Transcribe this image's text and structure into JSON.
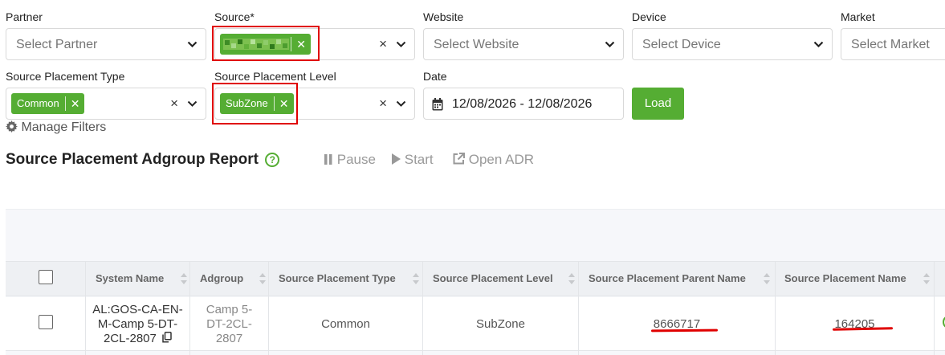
{
  "filters": {
    "partner": {
      "label": "Partner",
      "placeholder": "Select Partner"
    },
    "source": {
      "label": "Source*",
      "tag": ""
    },
    "website": {
      "label": "Website",
      "placeholder": "Select Website"
    },
    "device": {
      "label": "Device",
      "placeholder": "Select Device"
    },
    "market": {
      "label": "Market",
      "placeholder": "Select Market"
    },
    "placement_type": {
      "label": "Source Placement Type",
      "tag": "Common"
    },
    "placement_level": {
      "label": "Source Placement Level",
      "tag": "SubZone"
    },
    "date": {
      "label": "Date",
      "value": "12/08/2026 - 12/08/2026"
    },
    "load_label": "Load",
    "clear_glyph": "×",
    "tag_remove_glyph": "✕"
  },
  "manage_filters_label": "Manage Filters",
  "report": {
    "title": "Source Placement Adgroup Report",
    "help_glyph": "?",
    "toolbar": {
      "pause": "Pause",
      "start": "Start",
      "open_adr": "Open ADR"
    }
  },
  "table": {
    "columns": [
      "System Name",
      "Adgroup",
      "Source Placement Type",
      "Source Placement Level",
      "Source Placement Parent Name",
      "Source Placement Name"
    ],
    "rows": [
      {
        "system_name": [
          "AL:GOS-CA-EN-",
          "M-Camp 5-DT-",
          "2CL-2807"
        ],
        "adgroup": [
          "Camp 5-",
          "DT-2CL-",
          "2807"
        ],
        "placement_type": "Common",
        "placement_level": "SubZone",
        "parent_name": "8666717",
        "placement_name": "164205"
      }
    ]
  },
  "colors": {
    "accent": "#55ad33",
    "highlight": "#e00000"
  },
  "icons": [
    "chevron-down-icon",
    "clear-icon",
    "calendar-icon",
    "gear-icon",
    "help-icon",
    "pause-icon",
    "play-icon",
    "external-link-icon",
    "sort-icon",
    "copy-icon",
    "status-icon"
  ]
}
